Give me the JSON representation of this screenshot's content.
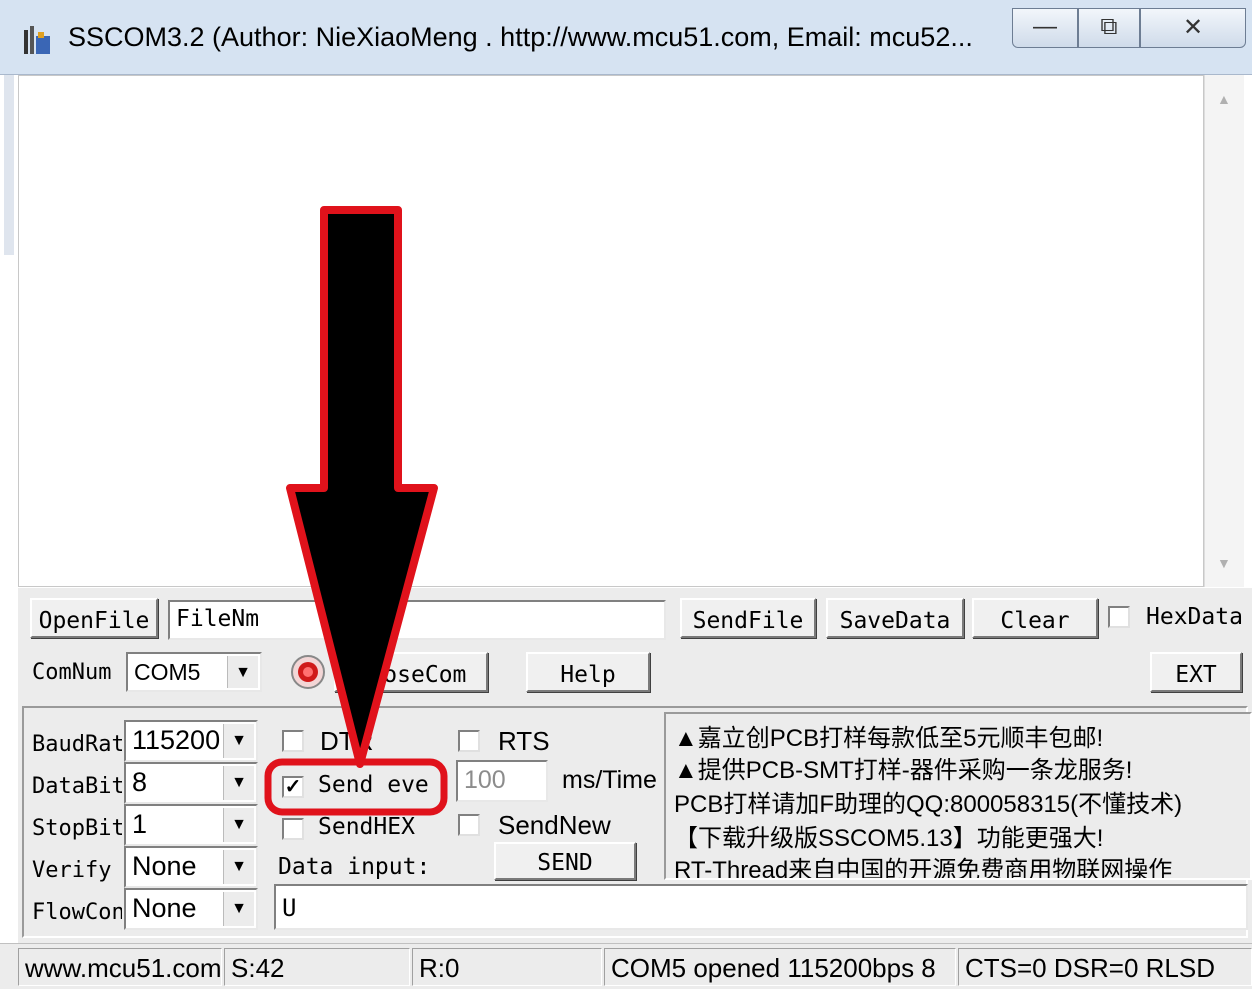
{
  "window": {
    "title": "SSCOM3.2 (Author: NieXiaoMeng .  http://www.mcu51.com,  Email: mcu52...",
    "min_glyph": "—",
    "max_glyph": "⧉",
    "close_glyph": "✕"
  },
  "toolbar1": {
    "open_file": "OpenFile",
    "file_name": "FileNm",
    "send_file": "SendFile",
    "save_data": "SaveData",
    "clear": "Clear",
    "hex_data": "HexData"
  },
  "toolbar2": {
    "com_num_label": "ComNum",
    "com_num_value": "COM5",
    "close_com": "CloseCom",
    "help": "Help",
    "ext": "EXT"
  },
  "settings": {
    "baud_label": "BaudRate",
    "baud_value": "115200",
    "databits_label": "DataBits",
    "databits_value": "8",
    "stopbits_label": "StopBits",
    "stopbits_value": "1",
    "verify_label": "Verify",
    "verify_value": "None",
    "flow_label": "FlowCon",
    "flow_value": "None"
  },
  "options": {
    "dtr_label": "DTR",
    "rts_label": "RTS",
    "send_every_label": "Send eve",
    "send_every_checked": true,
    "interval_value": "100",
    "interval_unit": "ms/Time",
    "send_hex_label": "SendHEX",
    "send_new_label": "SendNew",
    "data_input_label": "Data input:",
    "send_button": "SEND",
    "data_input_value": "U"
  },
  "promo_lines": [
    "▲嘉立创PCB打样每款低至5元顺丰包邮!",
    "▲提供PCB-SMT打样-器件采购一条龙服务!",
    "PCB打样请加F助理的QQ:800058315(不懂技术)",
    "【下载升级版SSCOM5.13】功能更强大!",
    "RT-Thread来自中国的开源免费商用物联网操作"
  ],
  "status": {
    "site": "www.mcu51.com",
    "sent": "S:42",
    "received": "R:0",
    "port_status": "COM5 opened 115200bps  8",
    "lines": "CTS=0 DSR=0 RLSD"
  },
  "annotation": {
    "arrow_color": "#000000",
    "outline_color": "#e0121b"
  },
  "icons": {
    "app": "sscom-app-icon",
    "port_indicator": "red-led-icon"
  }
}
